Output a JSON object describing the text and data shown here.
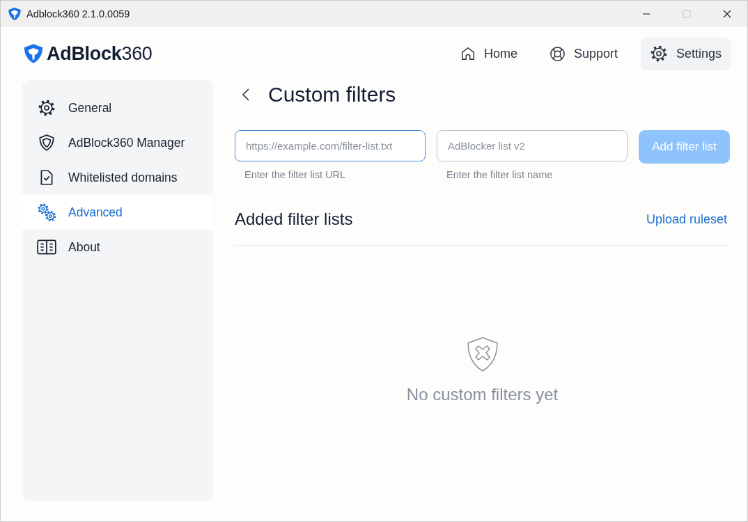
{
  "window": {
    "title": "Adblock360 2.1.0.0059",
    "controls": [
      {
        "kind": "minimize",
        "disabled": false
      },
      {
        "kind": "maximize",
        "disabled": true
      },
      {
        "kind": "close",
        "disabled": false
      }
    ]
  },
  "header": {
    "logo": "**AdBlock**360",
    "nav": [
      {
        "label": "Home",
        "kind": "home",
        "selected": false
      },
      {
        "label": "Support",
        "kind": "lifebuoy",
        "selected": false
      },
      {
        "label": "Settings",
        "kind": "gear",
        "selected": true
      }
    ]
  },
  "sidebar": {
    "items": [
      {
        "label": "General",
        "kind": "gear",
        "selected": false
      },
      {
        "label": "AdBlock360 Manager",
        "kind": "shield",
        "selected": false
      },
      {
        "label": "Whitelisted domains",
        "kind": "document",
        "selected": false
      },
      {
        "label": "Advanced",
        "kind": "gears",
        "selected": true
      },
      {
        "label": "About",
        "kind": "book",
        "selected": false
      }
    ]
  },
  "page": {
    "title": "Custom filters",
    "url_field": {
      "placeholder": "https://example.com/filter-list.txt",
      "hint": "Enter the filter list URL",
      "focused": true
    },
    "name_field": {
      "placeholder": "AdBlocker list v2",
      "hint": "Enter the filter list name",
      "focused": false
    },
    "add_button": {
      "label": "Add filter list",
      "disabled": true
    },
    "section_title": "Added filter lists",
    "upload_link": "Upload ruleset",
    "empty_state": {
      "message": "No custom filters yet"
    }
  }
}
